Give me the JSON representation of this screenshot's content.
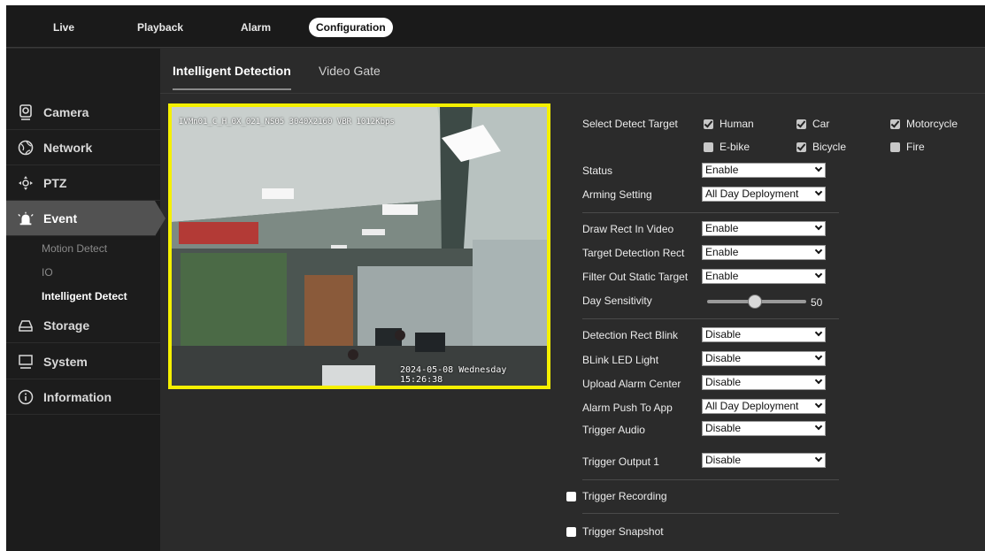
{
  "topnav": {
    "items": [
      {
        "label": "Live"
      },
      {
        "label": "Playback"
      },
      {
        "label": "Alarm"
      },
      {
        "label": "Configuration"
      }
    ]
  },
  "sidebar": {
    "items": [
      {
        "label": "Camera",
        "icon": "camera-icon"
      },
      {
        "label": "Network",
        "icon": "globe-icon"
      },
      {
        "label": "PTZ",
        "icon": "ptz-icon"
      },
      {
        "label": "Event",
        "icon": "alarm-icon"
      },
      {
        "label": "Storage",
        "icon": "storage-icon"
      },
      {
        "label": "System",
        "icon": "monitor-icon"
      },
      {
        "label": "Information",
        "icon": "info-icon"
      }
    ],
    "event_subitems": [
      "Motion Detect",
      "IO",
      "Intelligent Detect"
    ]
  },
  "tabs": [
    {
      "label": "Intelligent Detection"
    },
    {
      "label": "Video Gate"
    }
  ],
  "video": {
    "osd_top": "IVMn01_C_H_0X_021_NS05 3040X2160 VBR 1012Kbps",
    "osd_bottom": "2024-05-08 Wednesday 15:26:38",
    "border_color": "#f5f000"
  },
  "form": {
    "detect_target_label": "Select Detect Target",
    "targets": [
      {
        "label": "Human",
        "checked": true
      },
      {
        "label": "Car",
        "checked": true
      },
      {
        "label": "Motorcycle",
        "checked": true
      },
      {
        "label": "E-bike",
        "checked": false
      },
      {
        "label": "Bicycle",
        "checked": true
      },
      {
        "label": "Fire",
        "checked": false
      }
    ],
    "status": {
      "label": "Status",
      "value": "Enable"
    },
    "arming": {
      "label": "Arming Setting",
      "value": "All Day Deployment"
    },
    "draw_rect": {
      "label": "Draw Rect In Video",
      "value": "Enable"
    },
    "target_rect": {
      "label": "Target Detection Rect",
      "value": "Enable"
    },
    "filter_static": {
      "label": "Filter Out Static Target",
      "value": "Enable"
    },
    "day_sensitivity": {
      "label": "Day Sensitivity",
      "value": "50"
    },
    "rect_blink": {
      "label": "Detection Rect Blink",
      "value": "Disable"
    },
    "led_light": {
      "label": "BLink LED Light",
      "value": "Disable"
    },
    "upload_alarm": {
      "label": "Upload Alarm Center",
      "value": "Disable"
    },
    "alarm_push": {
      "label": "Alarm Push To App",
      "value": "All Day Deployment"
    },
    "trigger_audio": {
      "label": "Trigger Audio",
      "value": "Disable"
    },
    "trigger_output": {
      "label": "Trigger Output 1",
      "value": "Disable"
    },
    "trigger_recording": {
      "label": "Trigger Recording",
      "checked": false
    },
    "trigger_snapshot": {
      "label": "Trigger Snapshot",
      "checked": false
    }
  }
}
